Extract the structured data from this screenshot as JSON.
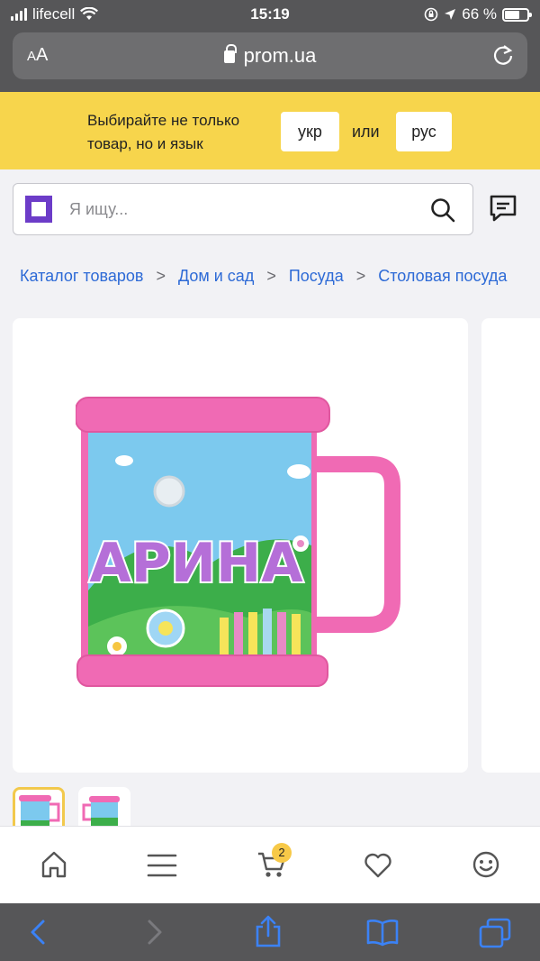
{
  "status": {
    "carrier": "lifecell",
    "time": "15:19",
    "battery": "66 %",
    "battery_level": 0.66
  },
  "browser": {
    "text_size_label": "AA",
    "url": "prom.ua"
  },
  "banner": {
    "text": "Выбирайте не только товар, но и язык",
    "ukr": "укр",
    "or": "или",
    "rus": "рус"
  },
  "search": {
    "placeholder": "Я ищу..."
  },
  "breadcrumb": [
    "Каталог товаров",
    "Дом и сад",
    "Посуда",
    "Столовая посуда"
  ],
  "product": {
    "mug_text": "АРИНА"
  },
  "bottom_nav": {
    "cart_count": "2",
    "items": [
      "home-icon",
      "menu-icon",
      "cart-icon",
      "heart-icon",
      "smiley-icon"
    ]
  },
  "safari_toolbar": [
    "back-icon",
    "forward-icon",
    "share-icon",
    "bookmarks-icon",
    "tabs-icon"
  ],
  "colors": {
    "banner": "#f7d54c",
    "link": "#2d6ad6",
    "brand": "#6c3cc8",
    "badge": "#f7c948",
    "safari_blue": "#3b82f6"
  }
}
